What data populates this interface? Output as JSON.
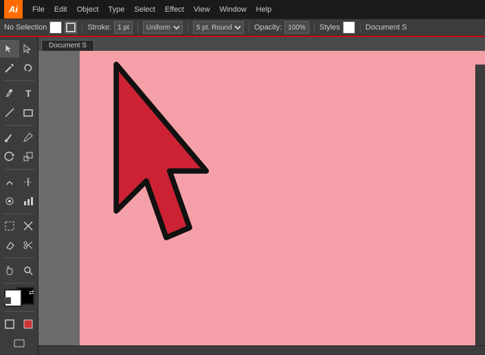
{
  "titlebar": {
    "logo": "Ai",
    "menu_items": [
      "File",
      "Edit",
      "Object",
      "Type",
      "Select",
      "Effect",
      "View",
      "Window",
      "Help"
    ]
  },
  "optionsbar": {
    "no_selection_label": "No Selection",
    "stroke_label": "Stroke:",
    "stroke_weight": "1 pt",
    "stroke_type": "Uniform",
    "brush_label": "5 pt. Round",
    "opacity_label": "Opacity:",
    "opacity_value": "100%",
    "styles_label": "Styles",
    "doc_label": "Document S"
  },
  "tab": {
    "label": "Document S"
  },
  "tools": [
    "selection",
    "direct-selection",
    "magic-wand",
    "lasso",
    "pen",
    "type",
    "line",
    "rect",
    "paintbrush",
    "pencil",
    "rotate",
    "scale",
    "warp",
    "width",
    "symbol",
    "chart",
    "artboard",
    "slice",
    "eraser",
    "scissors",
    "hand",
    "zoom"
  ]
}
